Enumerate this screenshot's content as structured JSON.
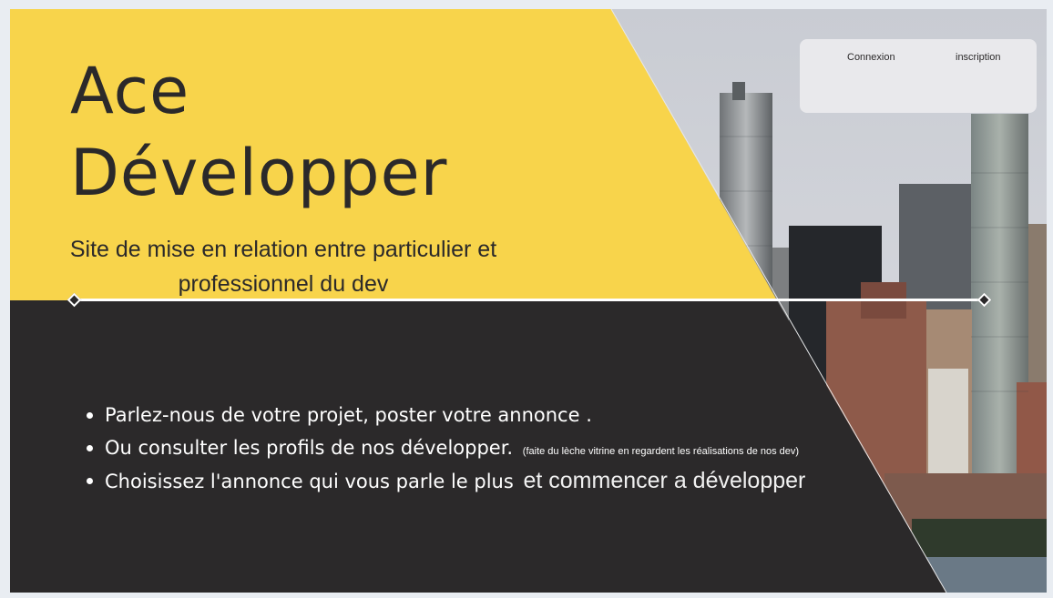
{
  "hero": {
    "title_line1": "Ace",
    "title_line2": "Développer",
    "subtitle": "Site de mise en relation entre particulier et professionnel du dev"
  },
  "auth": {
    "login_label": "Connexion",
    "signup_label": "inscription"
  },
  "features": [
    {
      "main": "Parlez-nous de votre projet, poster votre annonce ."
    },
    {
      "main": "Ou consulter les profils de nos développer.",
      "note": "(faite du lèche vitrine en regardent les réalisations de nos dev)"
    },
    {
      "main": "Choisissez l'annonce qui vous parle le plus",
      "tail": "et commencer a développer"
    }
  ],
  "colors": {
    "yellow": "#f8d44b",
    "dark": "#2b292a",
    "white": "#ffffff"
  }
}
